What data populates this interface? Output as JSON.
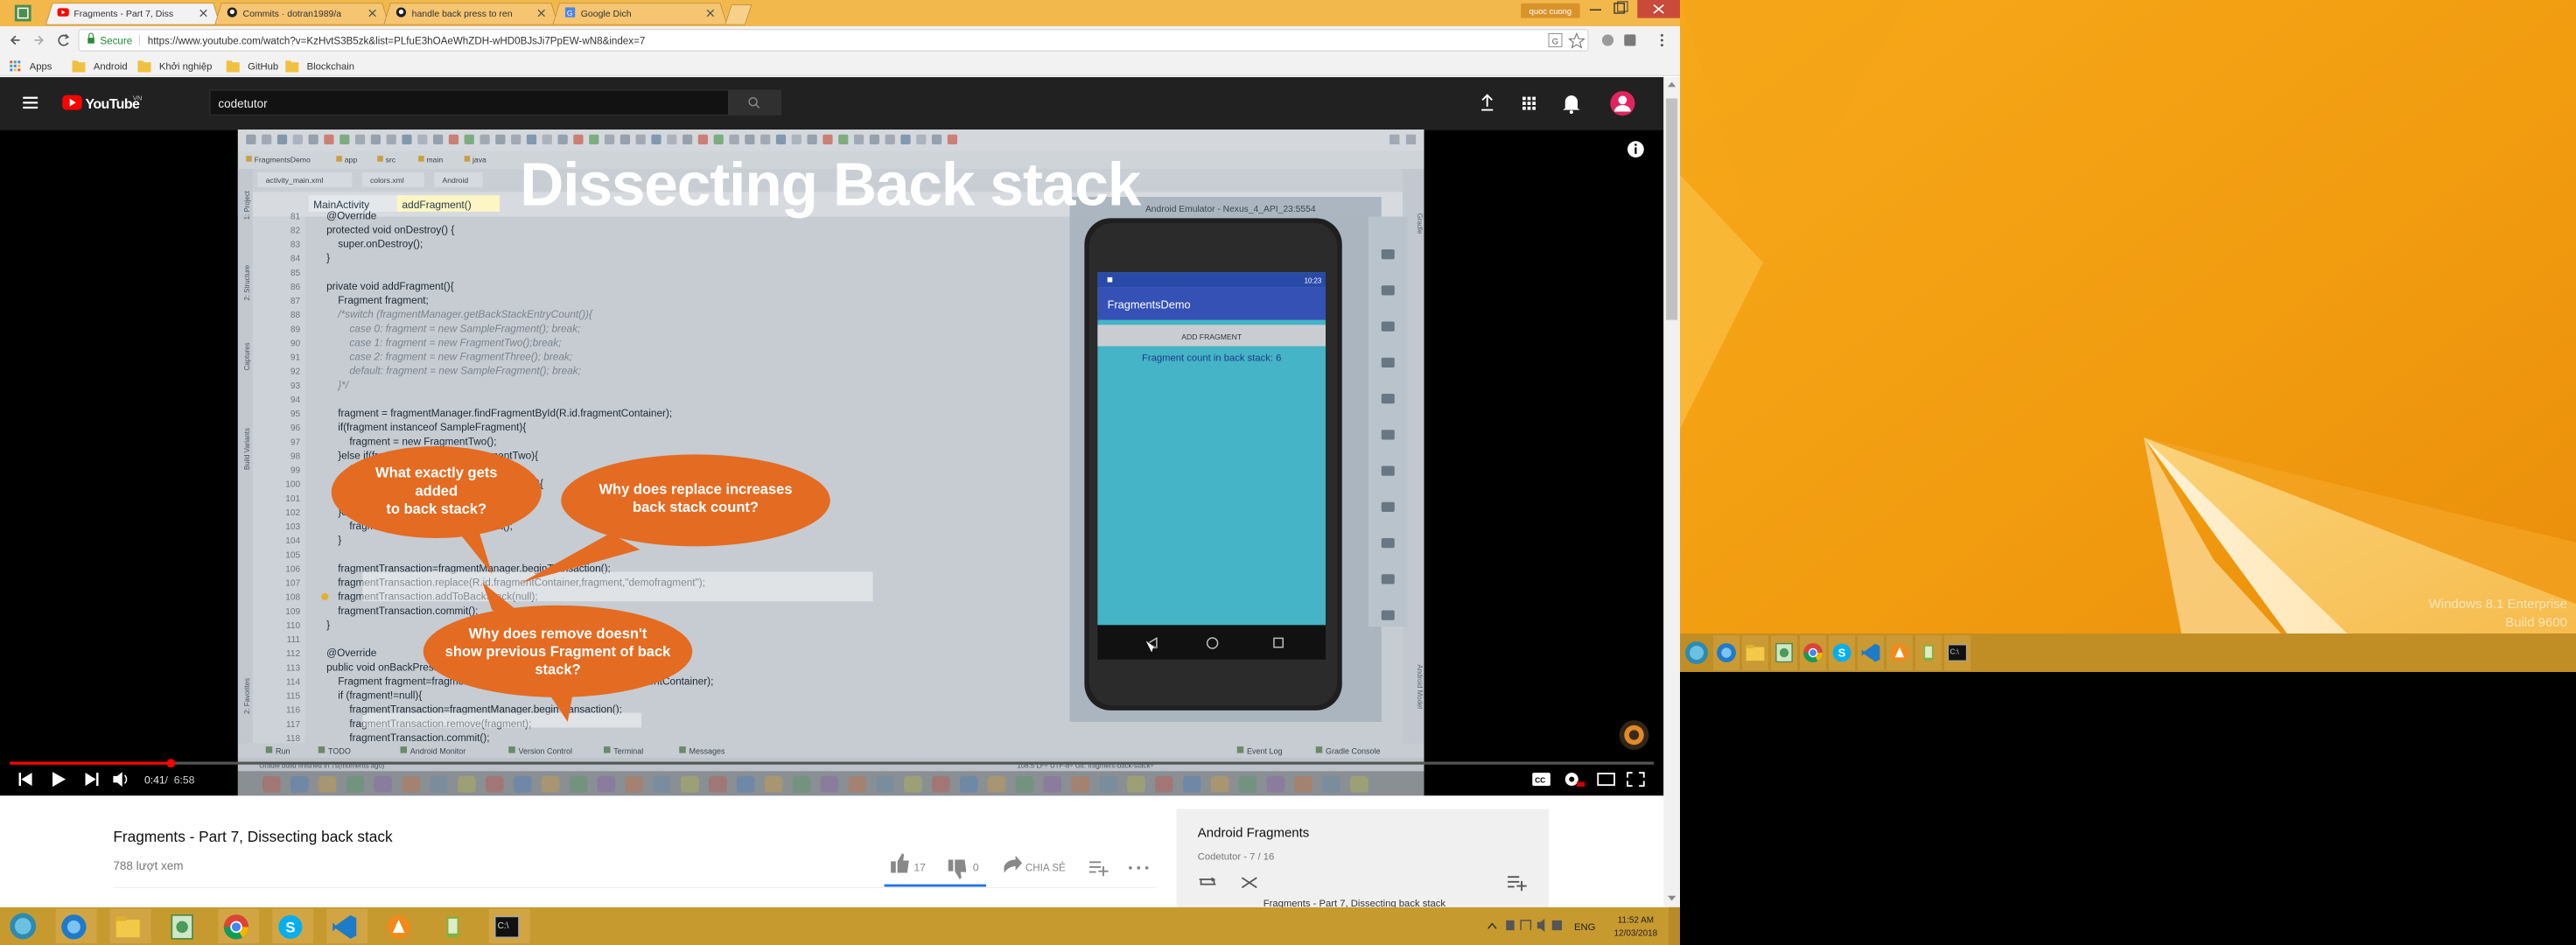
{
  "browser": {
    "tabs": [
      {
        "title": "Fragments - Part 7, Diss",
        "icon": "youtube-icon",
        "active": true
      },
      {
        "title": "Commits · dotran1989/a",
        "icon": "github-icon",
        "active": false
      },
      {
        "title": "handle back press to ren",
        "icon": "github-icon",
        "active": false
      },
      {
        "title": "Google Dich",
        "icon": "translate-icon",
        "active": false
      }
    ],
    "profile_name": "quoc cuong",
    "secure_label": "Secure",
    "url": "https://www.youtube.com/watch?v=KzHvtS3B5zk&list=PLfuE3hOAeWhZDH-wHD0BJsJi7PpEW-wN8&index=7",
    "bookmarks": [
      {
        "label": "Apps",
        "icon": "apps-grid-icon"
      },
      {
        "label": "Android",
        "icon": "folder-icon"
      },
      {
        "label": "Khởi nghiệp",
        "icon": "folder-icon"
      },
      {
        "label": "GitHub",
        "icon": "folder-icon"
      },
      {
        "label": "Blockchain",
        "icon": "folder-icon"
      }
    ]
  },
  "youtube": {
    "logo_text": "YouTube",
    "logo_suffix": "VN",
    "search_value": "codetutor",
    "accent_color": "#ff0000"
  },
  "video": {
    "slide_title": "Dissecting Back stack",
    "emulator_title": "Android Emulator - Nexus_4_API_23:5554",
    "ide": {
      "tabs": [
        "MainActivity",
        "addFragment()"
      ],
      "breadcrumbs": [
        "FragmentsDemo",
        "app",
        "src",
        "main",
        "java"
      ],
      "file_tabs": [
        "activity_main.xml",
        "colors.xml",
        "Android"
      ],
      "gutter_start": 81,
      "code_lines": [
        "    @Override",
        "    protected void onDestroy() {",
        "        super.onDestroy();",
        "    }",
        "",
        "    private void addFragment(){",
        "        Fragment fragment;",
        "        /*switch (fragmentManager.getBackStackEntryCount()){",
        "            case 0: fragment = new SampleFragment(); break;",
        "            case 1: fragment = new FragmentTwo();break;",
        "            case 2: fragment = new FragmentThree(); break;",
        "            default: fragment = new SampleFragment(); break;",
        "        }*/",
        "",
        "        fragment = fragmentManager.findFragmentById(R.id.fragmentContainer);",
        "        if(fragment instanceof SampleFragment){",
        "            fragment = new FragmentTwo();",
        "        }else if(fragment instanceof  FragmentTwo){",
        "            fragment = new FragmentThree();",
        "        }else if(fragment instanceof FragmentThree){",
        "            fragment = new SampleFragment();",
        "        }else{",
        "            fragment = new SampleFragment();",
        "        }",
        "",
        "        fragmentTransaction=fragmentManager.beginTransaction();",
        "        fragmentTransaction.replace(R.id.fragmentContainer,fragment,\"demofragment\");",
        "        fragmentTransaction.addToBackStack(null);",
        "        fragmentTransaction.commit();",
        "    }",
        "",
        "    @Override",
        "    public void onBackPressed() {",
        "        Fragment fragment=fragmentManager.findFragmentById(R.id.fragmentContainer);",
        "        if (fragment!=null){",
        "            fragmentTransaction=fragmentManager.beginTransaction();",
        "            fragmentTransaction.remove(fragment);",
        "            fragmentTransaction.commit();"
      ],
      "side_tabs": [
        "1: Project",
        "2: Structure",
        "Captures",
        "Build Variants",
        "2: Favorites"
      ],
      "bottom_tools": [
        "Run",
        "TODO",
        "Android Monitor",
        "Version Control",
        "Terminal",
        "Messages",
        "Event Log",
        "Gradle Console"
      ],
      "status_left": "Gradle build finished in 7s(moments ago)",
      "status_right": "108:5   LF÷   UTF-8÷   Git: fragment-back-stack÷"
    },
    "phone": {
      "status_time": "10:23",
      "app_title": "FragmentsDemo",
      "add_button_label": "ADD FRAGMENT",
      "count_text": "Fragment count in back stack: 6"
    },
    "bubbles": [
      {
        "text": [
          "What exactly gets",
          "added",
          "to back stack?"
        ]
      },
      {
        "text": [
          "Why does replace increases",
          "back stack count?"
        ]
      },
      {
        "text": [
          "Why does remove doesn't",
          "show previous Fragment of back",
          "stack?"
        ]
      }
    ],
    "controls": {
      "time_current": "0:41",
      "time_total": "6:58",
      "time_separator": "/",
      "progress": 0.098
    }
  },
  "details": {
    "title": "Fragments - Part 7, Dissecting back stack",
    "views": "788 lượt xem",
    "likes": "17",
    "dislikes": "0",
    "share_label": "CHIA SẺ"
  },
  "playlist": {
    "title": "Android Fragments",
    "subtitle": "Codetutor - 7 / 16",
    "next_item_title": "Fragments - Part 7, Dissecting back stack"
  },
  "taskbar_main": {
    "apps": [
      "ie-icon",
      "file-explorer-icon",
      "android-studio-icon",
      "chrome-icon",
      "skype-icon",
      "vscode-icon",
      "avast-icon",
      "android-sdk-icon",
      "cmd-icon"
    ],
    "language": "ENG",
    "time": "11:52 AM",
    "date": "12/03/2018"
  },
  "desktop2": {
    "watermark_line1": "Windows 8.1 Enterprise",
    "watermark_line2": "Build 9600",
    "taskbar_apps": [
      "ie-icon",
      "file-explorer-icon",
      "android-studio-icon",
      "chrome-icon",
      "skype-icon",
      "vscode-icon",
      "avast-icon",
      "android-sdk-icon",
      "cmd-icon"
    ]
  }
}
